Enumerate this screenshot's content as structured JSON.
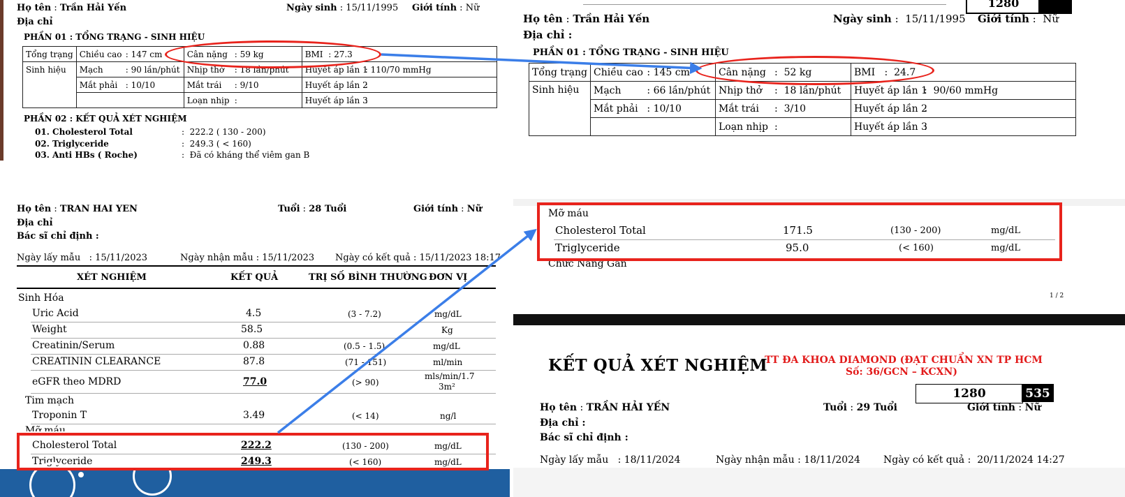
{
  "p1": {
    "ho_ten_label": "Họ tên",
    "ho_ten": "Trần Hải Yến",
    "ngay_sinh_label": "Ngày sinh",
    "ngay_sinh": "15/11/1995",
    "gioi_tinh_label": "Giới tính",
    "gioi_tinh": "Nữ",
    "dia_chi_label": "Địa chỉ",
    "section1": "PHẦN 01 : TỔNG TRẠNG - SINH HIỆU",
    "tong_trang": "Tổng trạng",
    "sinh_hieu": "Sinh hiệu",
    "chieu_cao_label": "Chiều cao",
    "chieu_cao": "147 cm",
    "can_nang_label": "Cân nặng",
    "can_nang": "59 kg",
    "bmi_label": "BMI",
    "bmi": "27.3",
    "mach_label": "Mạch",
    "mach": "90 lần/phút",
    "nhip_tho_label": "Nhịp thở",
    "nhip_tho": "18 lần/phút",
    "ha1_label": "Huyết áp lần 1",
    "ha1": "110/70 mmHg",
    "mat_phai_label": "Mắt phải",
    "mat_phai": "10/10",
    "mat_trai_label": "Mắt trái",
    "mat_trai": "9/10",
    "ha2_label": "Huyết áp lần 2",
    "loan_nhip_label": "Loạn nhịp",
    "ha3_label": "Huyết áp lần 3",
    "section2": "PHẦN 02 : KẾT QUẢ XÉT NGHIỆM",
    "tests": [
      {
        "name": "01. Cholesterol Total",
        "value": "222.2 ( 130 - 200)"
      },
      {
        "name": "02. Triglyceride",
        "value": "249.3 ( < 160)"
      },
      {
        "name": "03. Anti HBs ( Roche)",
        "value": "Đã có kháng thể viêm gan B"
      }
    ]
  },
  "p2": {
    "ho_ten_label": "Họ tên",
    "ho_ten": "Trần Hải Yến",
    "ngay_sinh_label": "Ngày sinh",
    "ngay_sinh": "15/11/1995",
    "gioi_tinh_label": "Giới tính",
    "gioi_tinh": "Nữ",
    "dia_chi_label": "Địa chỉ",
    "box_top": "1280",
    "section1": "PHẦN 01 : TỔNG TRẠNG - SINH HIỆU",
    "tong_trang": "Tổng trạng",
    "sinh_hieu": "Sinh hiệu",
    "chieu_cao_label": "Chiều cao",
    "chieu_cao": "145 cm",
    "can_nang_label": "Cân nặng",
    "can_nang": "52 kg",
    "bmi_label": "BMI",
    "bmi": "24.7",
    "mach_label": "Mạch",
    "mach": "66 lần/phút",
    "nhip_tho_label": "Nhịp thở",
    "nhip_tho": "18 lần/phút",
    "ha1_label": "Huyết áp lần 1",
    "ha1": "90/60 mmHg",
    "mat_phai_label": "Mắt phải",
    "mat_phai": "10/10",
    "mat_trai_label": "Mắt trái",
    "mat_trai": "3/10",
    "ha2_label": "Huyết áp lần 2",
    "loan_nhip_label": "Loạn nhịp",
    "ha3_label": "Huyết áp lần 3"
  },
  "p3": {
    "ho_ten_label": "Họ tên",
    "ho_ten": "TRAN HAI YEN",
    "tuoi_label": "Tuổi",
    "tuoi": "28 Tuổi",
    "gioi_tinh_label": "Giới tính",
    "gioi_tinh": "Nữ",
    "dia_chi_label": "Địa chỉ",
    "bac_si_label": "Bác sĩ chỉ định",
    "ngay_lay_label": "Ngày lấy mẫu",
    "ngay_lay": "15/11/2023",
    "ngay_nhan_label": "Ngày nhận mẫu",
    "ngay_nhan": "15/11/2023",
    "ngay_kq_label": "Ngày có kết quả",
    "ngay_kq": "15/11/2023 18:17",
    "headers": [
      "XÉT NGHIỆM",
      "KẾT QUẢ",
      "TRỊ SỐ BÌNH THƯỜNG",
      "ĐƠN VỊ"
    ],
    "groups": {
      "sinh_hoa": "Sinh Hóa",
      "tim_mach": "Tim mạch",
      "mo_mau": "Mỡ máu"
    },
    "rows": [
      {
        "name": "Uric Acid",
        "value": "4.5",
        "range": "(3 - 7.2)",
        "unit": "mg/dL"
      },
      {
        "name": "Weight",
        "value": "58.5",
        "range": "",
        "unit": "Kg"
      },
      {
        "name": "Creatinin/Serum",
        "value": "0.88",
        "range": "(0.5 - 1.5)",
        "unit": "mg/dL"
      },
      {
        "name": "CREATININ CLEARANCE",
        "value": "87.8",
        "range": "(71 - 151)",
        "unit": "ml/min"
      },
      {
        "name": "eGFR theo MDRD",
        "value": "77.0",
        "range": "(> 90)",
        "unit": "mls/min/1.7",
        "unit2": "3m²"
      },
      {
        "name": "Troponin T",
        "value": "3.49",
        "range": "(< 14)",
        "unit": "ng/l"
      },
      {
        "name": "Cholesterol Total",
        "value": "222.2",
        "range": "(130 - 200)",
        "unit": "mg/dL"
      },
      {
        "name": "Triglyceride",
        "value": "249.3",
        "range": "(< 160)",
        "unit": "mg/dL"
      }
    ]
  },
  "p4": {
    "group": "Mỡ máu",
    "rows": [
      {
        "name": "Cholesterol Total",
        "value": "171.5",
        "range": "(130 - 200)",
        "unit": "mg/dL"
      },
      {
        "name": "Triglyceride",
        "value": "95.0",
        "range": "(< 160)",
        "unit": "mg/dL"
      }
    ],
    "next_group": "Chức Năng Gan",
    "page": "1 / 2"
  },
  "p5": {
    "title": "KẾT QUẢ XÉT NGHIỆM",
    "clinic_line1": "TT ĐA KHOA DIAMOND (ĐẠT CHUẨN XN TP HCM",
    "clinic_line2": "Số: 36/GCN – KCXN)",
    "box_num": "1280",
    "box_dark": "535",
    "ho_ten_label": "Họ tên",
    "ho_ten": "TRẦN HẢI YẾN",
    "tuoi_label": "Tuổi",
    "tuoi": "29 Tuổi",
    "gioi_tinh_label": "Giới tính",
    "gioi_tinh": "Nữ",
    "dia_chi_label": "Địa chỉ",
    "bac_si_label": "Bác sĩ chỉ định",
    "ngay_lay_label": "Ngày lấy mẫu",
    "ngay_lay": "18/11/2024",
    "ngay_nhan_label": "Ngày nhận mẫu",
    "ngay_nhan": "18/11/2024",
    "ngay_kq_label": "Ngày có kết quả",
    "ngay_kq": "20/11/2024 14:27"
  },
  "colors": {
    "highlight": "#e8231c",
    "arrow": "#3b7ee8"
  }
}
